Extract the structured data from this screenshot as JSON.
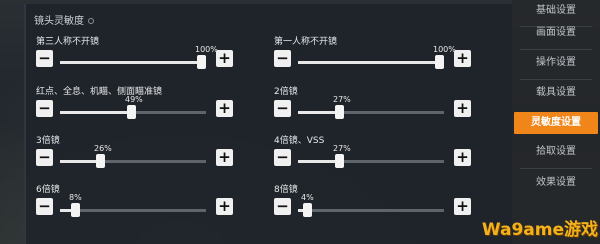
{
  "section": {
    "title": "镜头灵敏度"
  },
  "sliders": [
    {
      "label": "第三人称不开镜",
      "value": 100,
      "value_text": "100%"
    },
    {
      "label": "第一人称不开镜",
      "value": 100,
      "value_text": "100%"
    },
    {
      "label": "红点、全息、机瞄、侧面瞄准镜",
      "value": 49,
      "value_text": "49%"
    },
    {
      "label": "2倍镜",
      "value": 27,
      "value_text": "27%"
    },
    {
      "label": "3倍镜",
      "value": 26,
      "value_text": "26%"
    },
    {
      "label": "4倍镜、VSS",
      "value": 27,
      "value_text": "27%"
    },
    {
      "label": "6倍镜",
      "value": 8,
      "value_text": "8%"
    },
    {
      "label": "8倍镜",
      "value": 4,
      "value_text": "4%"
    }
  ],
  "sidebar": {
    "items": [
      {
        "label": "基础设置",
        "active": false
      },
      {
        "label": "画面设置",
        "active": false
      },
      {
        "label": "操作设置",
        "active": false
      },
      {
        "label": "载具设置",
        "active": false
      },
      {
        "label": "灵敏度设置",
        "active": true
      },
      {
        "label": "拾取设置",
        "active": false
      },
      {
        "label": "效果设置",
        "active": false
      }
    ]
  },
  "buttons": {
    "minus": "−",
    "plus": "+"
  },
  "watermark": {
    "text": "Wa9ame游戏"
  },
  "colors": {
    "accent": "#f08519",
    "track": "#5d646a",
    "fill": "#e8e8e8"
  }
}
